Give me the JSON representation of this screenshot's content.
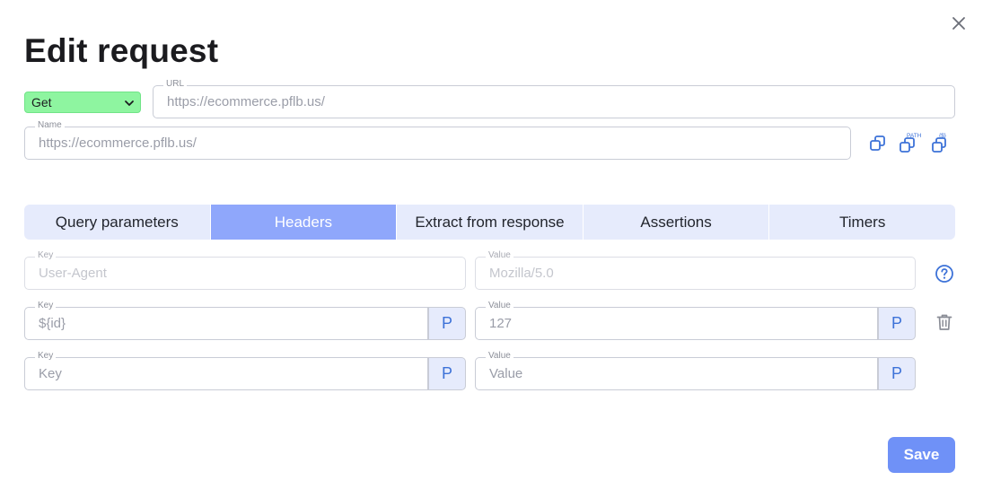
{
  "dialog": {
    "title": "Edit request",
    "close_icon": "close-icon"
  },
  "request": {
    "method": "Get",
    "url_label": "URL",
    "url_value": "https://ecommerce.pflb.us/",
    "name_label": "Name",
    "name_value": "https://ecommerce.pflb.us/"
  },
  "toolbar_icons": [
    {
      "name": "copy-icon"
    },
    {
      "name": "copy-path-icon",
      "badge": "PATH"
    },
    {
      "name": "copy-variable-icon",
      "badge": "{$}"
    }
  ],
  "tabs": [
    {
      "label": "Query parameters",
      "active": false
    },
    {
      "label": "Headers",
      "active": true
    },
    {
      "label": "Extract from response",
      "active": false
    },
    {
      "label": "Assertions",
      "active": false
    },
    {
      "label": "Timers",
      "active": false
    }
  ],
  "headers": [
    {
      "key_label": "Key",
      "key_value": "User-Agent",
      "value_label": "Value",
      "value_value": "Mozilla/5.0",
      "disabled": true,
      "side_icon": "help-icon"
    },
    {
      "key_label": "Key",
      "key_value": "${id}",
      "value_label": "Value",
      "value_value": "127",
      "disabled": false,
      "p_key": "P",
      "p_value": "P",
      "side_icon": "trash-icon"
    },
    {
      "key_label": "Key",
      "key_value": "Key",
      "value_label": "Value",
      "value_value": "Value",
      "disabled": false,
      "p_key": "P",
      "p_value": "P"
    }
  ],
  "footer": {
    "save_label": "Save"
  },
  "colors": {
    "accent": "#6f91f7",
    "tab_active": "#8fa7fb",
    "tab_bg": "#e6ebfc",
    "method_bg": "#8ef5a0",
    "icon_blue": "#3d72d8"
  }
}
